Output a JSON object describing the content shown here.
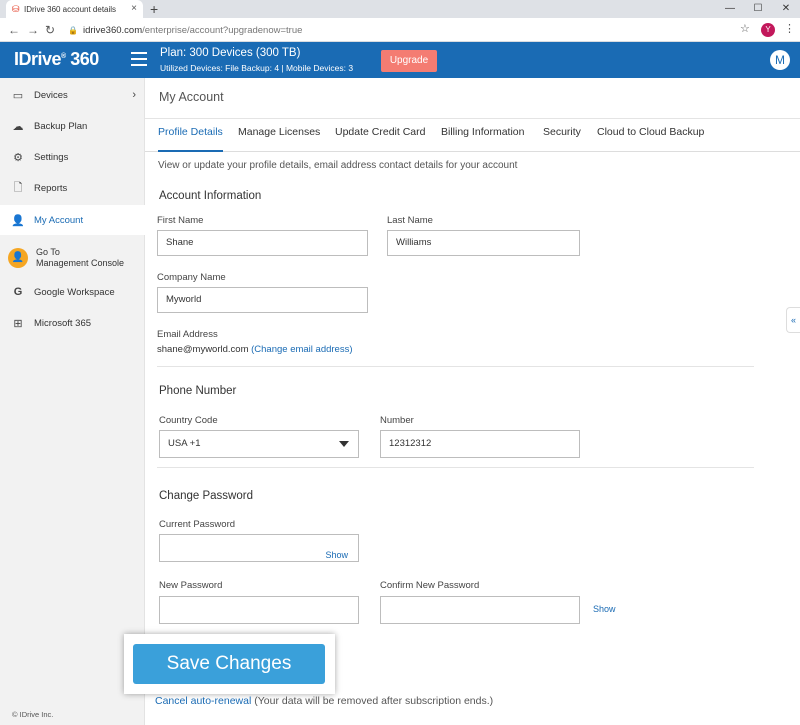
{
  "browser": {
    "tab_title": "IDrive 360 account details",
    "tab_close": "×",
    "new_tab": "+",
    "url_host": "idrive360.com",
    "url_path": "/enterprise/account?upgradenow=true",
    "profile_initial": "Y",
    "win_min": "—",
    "win_max": "☐",
    "win_close": "✕"
  },
  "header": {
    "logo": "IDrive",
    "logo_mark": "®",
    "logo_num": " 360",
    "plan_title": "Plan: 300 Devices (300 TB)",
    "plan_sub": "Utilized Devices: File Backup: 4 |  Mobile Devices: 3",
    "upgrade_label": "Upgrade",
    "avatar_initial": "M"
  },
  "sidebar": {
    "items": [
      {
        "label": "Devices",
        "icon": "devices-icon"
      },
      {
        "label": "Backup Plan",
        "icon": "cloud-backup-icon"
      },
      {
        "label": "Settings",
        "icon": "gear-icon"
      },
      {
        "label": "Reports",
        "icon": "document-icon"
      },
      {
        "label": "My Account",
        "icon": "user-icon"
      },
      {
        "label": "Go To",
        "label2": "Management Console",
        "icon": "console-icon"
      },
      {
        "label": "Google Workspace",
        "icon": "google-icon"
      },
      {
        "label": "Microsoft 365",
        "icon": "windows-icon"
      }
    ],
    "copyright": "© IDrive Inc."
  },
  "main": {
    "title": "My Account",
    "tabs": [
      "Profile Details",
      "Manage Licenses",
      "Update Credit Card",
      "Billing Information",
      "Security",
      "Cloud to Cloud Backup"
    ],
    "intro": "View or update your profile details, email address contact details for your account",
    "account_info": {
      "heading": "Account Information",
      "first_name_label": "First Name",
      "first_name": "Shane",
      "last_name_label": "Last Name",
      "last_name": "Williams",
      "company_label": "Company Name",
      "company": "Myworld",
      "email_label": "Email Address",
      "email": "shane@myworld.com",
      "change_email": "(Change email address)"
    },
    "phone": {
      "heading": "Phone Number",
      "country_label": "Country Code",
      "country_value": "USA +1",
      "number_label": "Number",
      "number_value": "12312312"
    },
    "password": {
      "heading": "Change Password",
      "current_label": "Current Password",
      "new_label": "New Password",
      "confirm_label": "Confirm New Password",
      "show": "Show"
    },
    "save_label": "Save Changes",
    "cancel_link": "Cancel auto-renewal",
    "cancel_note": " (Your data will be removed after subscription ends.)"
  },
  "colors": {
    "brand_blue": "#1a6bb4",
    "upgrade": "#f47c72",
    "save": "#3aa0da"
  }
}
